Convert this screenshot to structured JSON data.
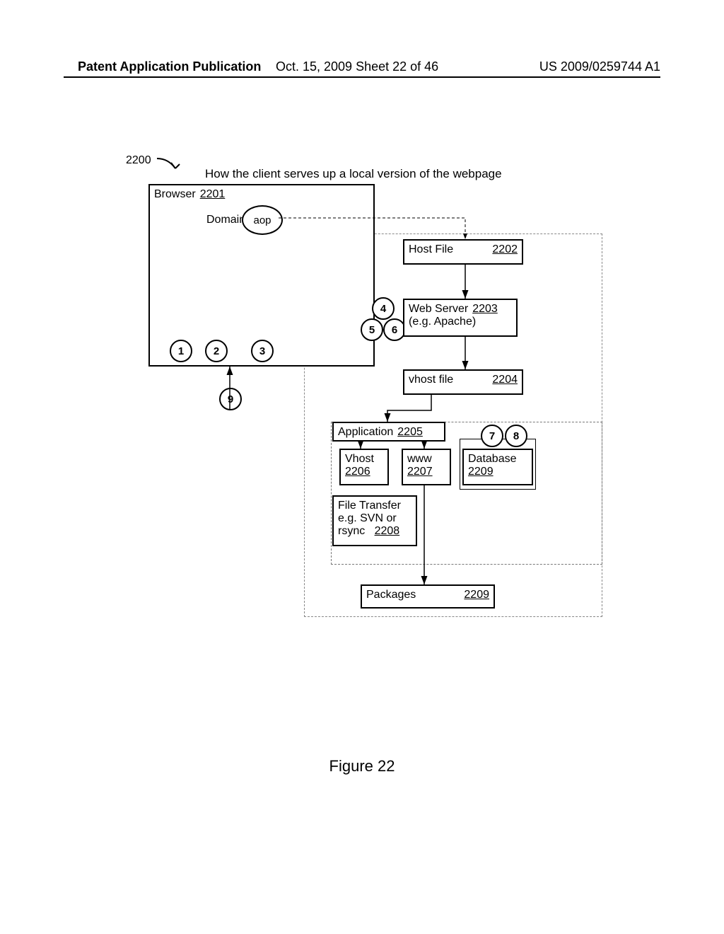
{
  "header": {
    "left": "Patent Application Publication",
    "center": "Oct. 15, 2009  Sheet 22 of 46",
    "right": "US 2009/0259744 A1"
  },
  "figure": {
    "number": "2200",
    "title": "How the client serves up a local version of the webpage",
    "caption": "Figure 22"
  },
  "boxes": {
    "browser": {
      "label": "Browser",
      "ref": "2201"
    },
    "domain_label": "Domain",
    "aop": "aop",
    "hostfile": {
      "label": "Host File",
      "ref": "2202"
    },
    "webserver": {
      "label": "Web Server",
      "ref": "2203",
      "sub": "(e.g. Apache)"
    },
    "vhostfile": {
      "label": "vhost file",
      "ref": "2204"
    },
    "application": {
      "label": "Application",
      "ref": "2205"
    },
    "vhost": {
      "label": "Vhost",
      "ref": "2206"
    },
    "www": {
      "label": "www",
      "ref": "2207"
    },
    "database": {
      "label": "Database",
      "ref": "2209"
    },
    "file_transfer": {
      "line1": "File Transfer",
      "line2": "e.g. SVN or",
      "line3": "rsync",
      "ref": "2208"
    },
    "packages": {
      "label": "Packages",
      "ref": "2209"
    }
  },
  "circles": {
    "n1": "1",
    "n2": "2",
    "n3": "3",
    "n4": "4",
    "n5": "5",
    "n6": "6",
    "n7": "7",
    "n8": "8",
    "n9": "9"
  }
}
